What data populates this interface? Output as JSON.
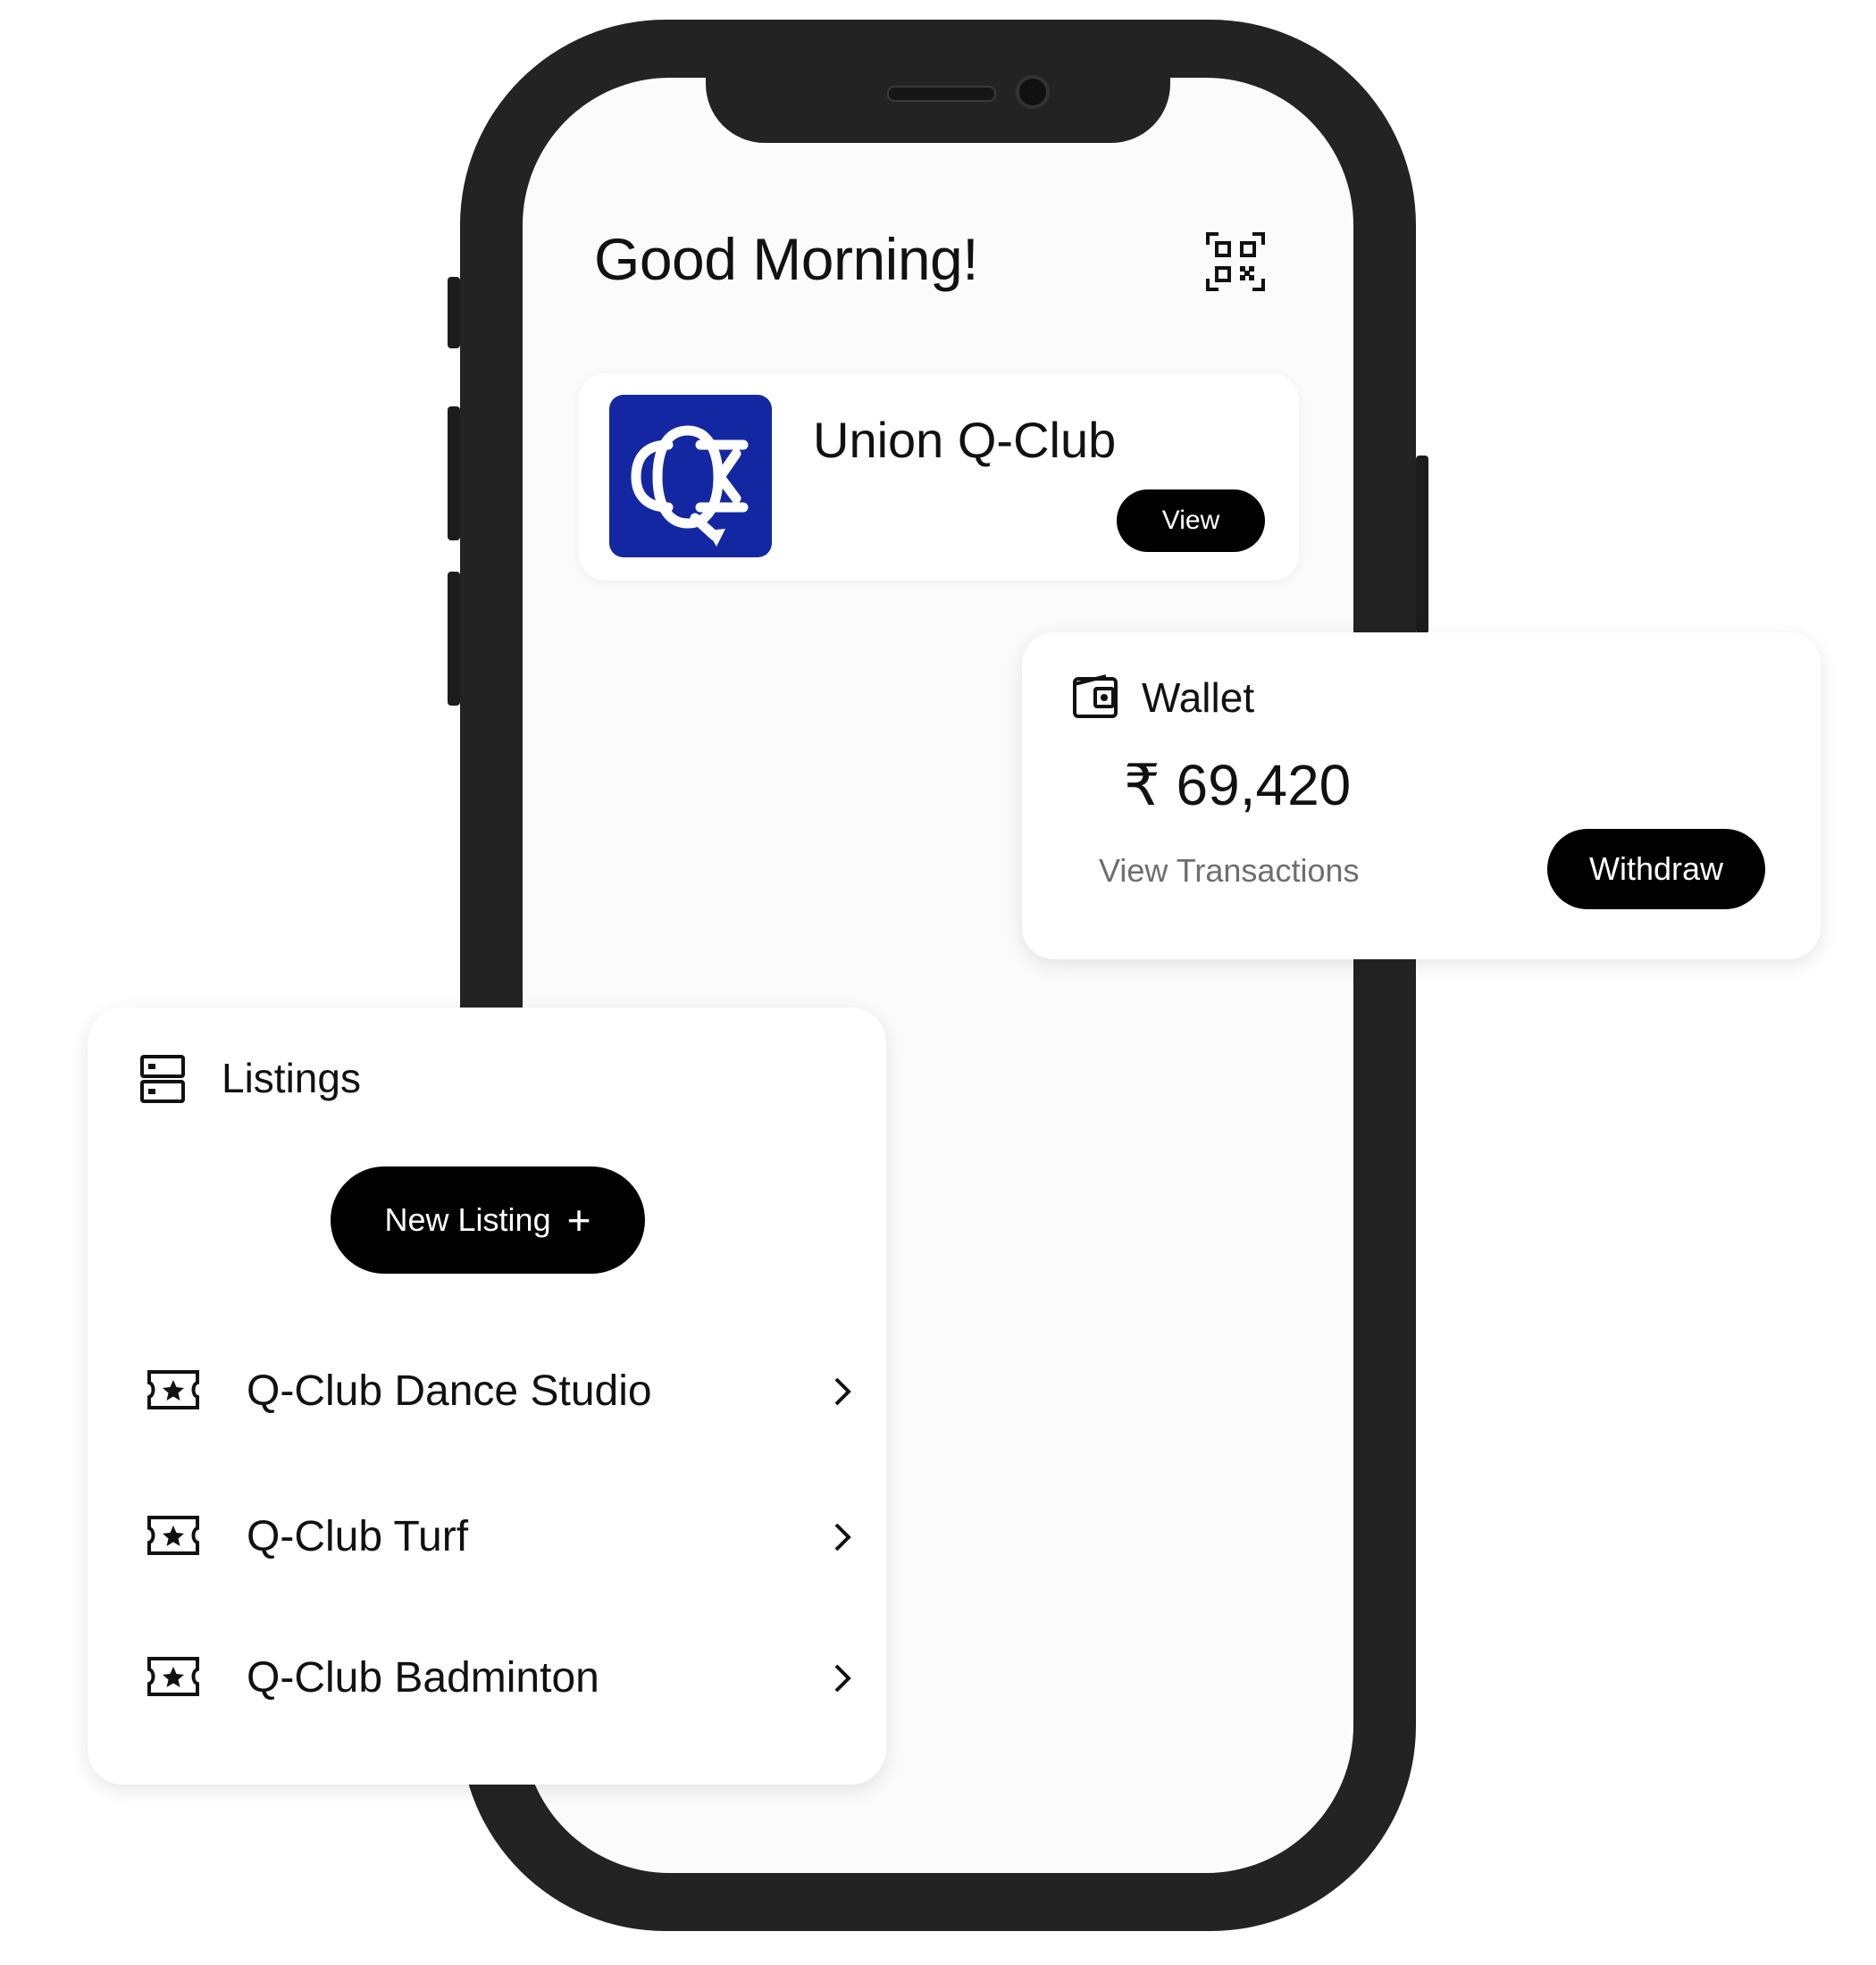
{
  "home": {
    "greeting": "Good Morning!",
    "qr_icon": "qr-code-icon"
  },
  "club": {
    "name": "Union Q-Club",
    "view_label": "View",
    "logo_color": "#1427a3",
    "logo_icon": "union-q-club-logo"
  },
  "wallet": {
    "title": "Wallet",
    "balance": "₹ 69,420",
    "transactions_label": "View Transactions",
    "withdraw_label": "Withdraw",
    "icon": "wallet-icon"
  },
  "listings": {
    "title": "Listings",
    "new_listing_label": "New Listing",
    "new_listing_icon": "plus-icon",
    "icon": "listings-icon",
    "items": [
      {
        "label": "Q-Club Dance Studio",
        "icon": "ticket-star-icon"
      },
      {
        "label": "Q-Club Turf",
        "icon": "ticket-star-icon"
      },
      {
        "label": "Q-Club Badminton",
        "icon": "ticket-star-icon"
      }
    ]
  },
  "colors": {
    "button": "#000000",
    "button_text": "#ffffff",
    "phone_frame": "#232323",
    "muted_text": "#6e6e6e"
  }
}
